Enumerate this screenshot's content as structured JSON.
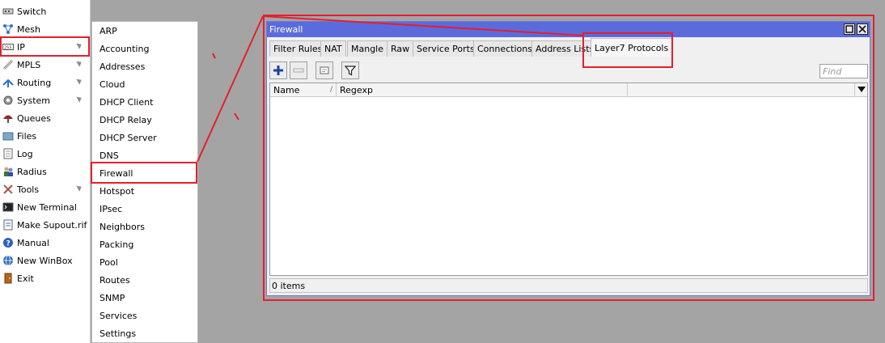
{
  "sidebar": {
    "items": [
      {
        "label": "Switch",
        "icon": "switch-icon"
      },
      {
        "label": "Mesh",
        "icon": "mesh-icon"
      },
      {
        "label": "IP",
        "icon": "ip-icon"
      },
      {
        "label": "MPLS",
        "icon": "mpls-icon"
      },
      {
        "label": "Routing",
        "icon": "routing-icon"
      },
      {
        "label": "System",
        "icon": "gear-icon"
      },
      {
        "label": "Queues",
        "icon": "queues-icon"
      },
      {
        "label": "Files",
        "icon": "folder-icon"
      },
      {
        "label": "Log",
        "icon": "log-icon"
      },
      {
        "label": "Radius",
        "icon": "users-icon"
      },
      {
        "label": "Tools",
        "icon": "tools-icon"
      },
      {
        "label": "New Terminal",
        "icon": "terminal-icon"
      },
      {
        "label": "Make Supout.rif",
        "icon": "document-icon"
      },
      {
        "label": "Manual",
        "icon": "help-icon"
      },
      {
        "label": "New WinBox",
        "icon": "globe-icon"
      },
      {
        "label": "Exit",
        "icon": "exit-icon"
      }
    ]
  },
  "ip_submenu": {
    "items": [
      "ARP",
      "Accounting",
      "Addresses",
      "Cloud",
      "DHCP Client",
      "DHCP Relay",
      "DHCP Server",
      "DNS",
      "Firewall",
      "Hotspot",
      "IPsec",
      "Neighbors",
      "Packing",
      "Pool",
      "Routes",
      "SNMP",
      "Services",
      "Settings"
    ]
  },
  "firewall_window": {
    "title": "Firewall",
    "tabs": [
      "Filter Rules",
      "NAT",
      "Mangle",
      "Raw",
      "Service Ports",
      "Connections",
      "Address Lists",
      "Layer7 Protocols"
    ],
    "active_tab": "Layer7 Protocols",
    "find_placeholder": "Find",
    "columns": [
      "Name",
      "Regexp"
    ],
    "status": "0 items"
  },
  "colors": {
    "accent_red": "#e3202c",
    "title_bar": "#5c6bdc"
  }
}
